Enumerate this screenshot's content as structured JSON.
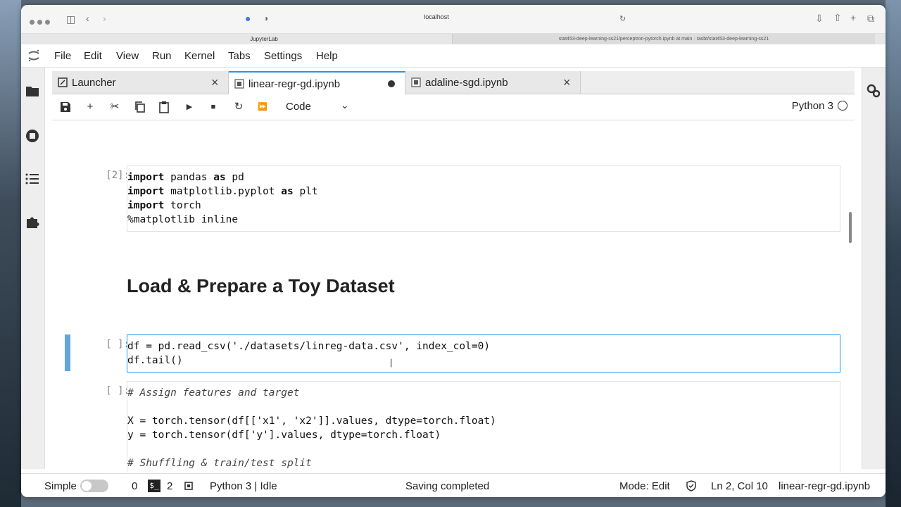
{
  "browser": {
    "url": "localhost",
    "tab_active": "JupyterLab",
    "tab_other": "stat453-deep-learning-ss21/perceptron-pytorch.ipynb at main · rasbt/stat453-deep-learning-ss21"
  },
  "menu": [
    "File",
    "Edit",
    "View",
    "Run",
    "Kernel",
    "Tabs",
    "Settings",
    "Help"
  ],
  "doc_tabs": [
    {
      "label": "Launcher"
    },
    {
      "label": "linear-regr-gd.ipynb"
    },
    {
      "label": "adaline-sgd.ipynb"
    }
  ],
  "toolbar": {
    "cell_type": "Code",
    "kernel_name": "Python 3"
  },
  "notebook": {
    "cell1": {
      "prompt": "[2]:",
      "lines": [
        "import pandas as pd",
        "import matplotlib.pyplot as plt",
        "import torch",
        "%matplotlib inline"
      ]
    },
    "heading": "Load & Prepare a Toy Dataset",
    "cell2": {
      "prompt": "[ ]:",
      "lines": [
        "df = pd.read_csv('./datasets/linreg-data.csv', index_col=0)",
        "df.tail()"
      ]
    },
    "cell3": {
      "prompt": "[ ]:",
      "lines": [
        "# Assign features and target",
        "",
        "X = torch.tensor(df[['x1', 'x2']].values, dtype=torch.float)",
        "y = torch.tensor(df['y'].values, dtype=torch.float)",
        "",
        "# Shuffling & train/test split"
      ]
    }
  },
  "status": {
    "mode_label": "Simple",
    "count_a": "0",
    "count_b": "2",
    "kernel_status": "Python 3 | Idle",
    "message": "Saving completed",
    "edit_mode": "Mode: Edit",
    "position": "Ln 2, Col 10",
    "filename": "linear-regr-gd.ipynb"
  }
}
